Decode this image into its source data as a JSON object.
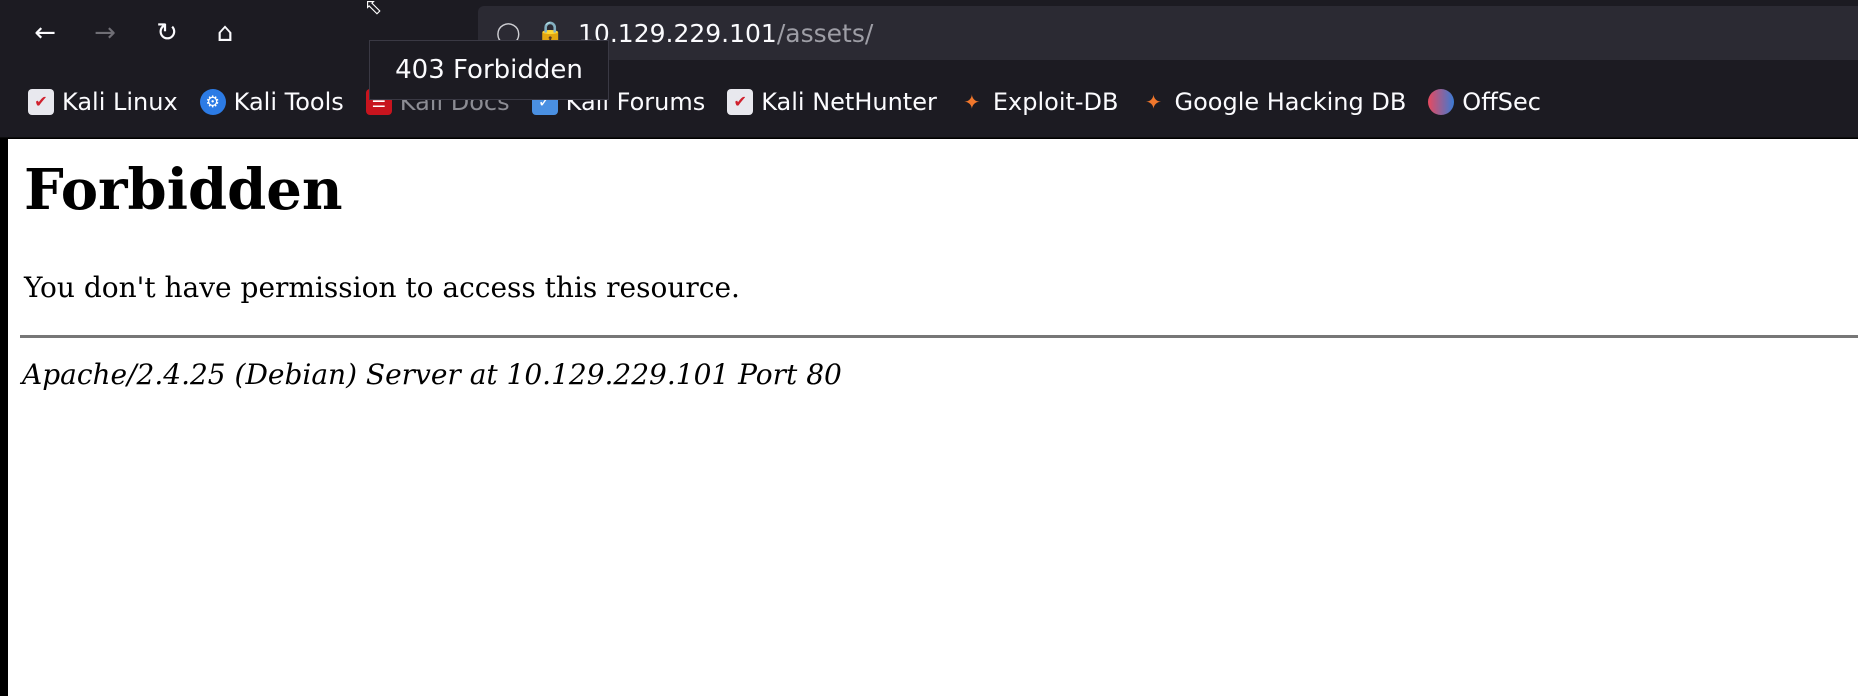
{
  "urlbar": {
    "host": "10.129.229.101",
    "path": "/assets/"
  },
  "tooltip": {
    "text": "403 Forbidden"
  },
  "bookmarks": [
    {
      "label": "Kali Linux",
      "icon": "kali-icon"
    },
    {
      "label": "Kali Tools",
      "icon": "kali-tools-icon"
    },
    {
      "label": "Kali Docs",
      "icon": "kali-docs-icon"
    },
    {
      "label": "Kali Forums",
      "icon": "kali-forums-icon"
    },
    {
      "label": "Kali NetHunter",
      "icon": "kali-icon"
    },
    {
      "label": "Exploit-DB",
      "icon": "exploit-db-icon"
    },
    {
      "label": "Google Hacking DB",
      "icon": "exploit-db-icon"
    },
    {
      "label": "OffSec",
      "icon": "offsec-icon"
    }
  ],
  "page": {
    "heading": "Forbidden",
    "message": "You don't have permission to access this resource.",
    "server_signature": "Apache/2.4.25 (Debian) Server at 10.129.229.101 Port 80"
  },
  "colors": {
    "toolbar_bg": "#1c1b22",
    "urlbar_bg": "#2b2a33",
    "page_bg": "#ffffff"
  }
}
